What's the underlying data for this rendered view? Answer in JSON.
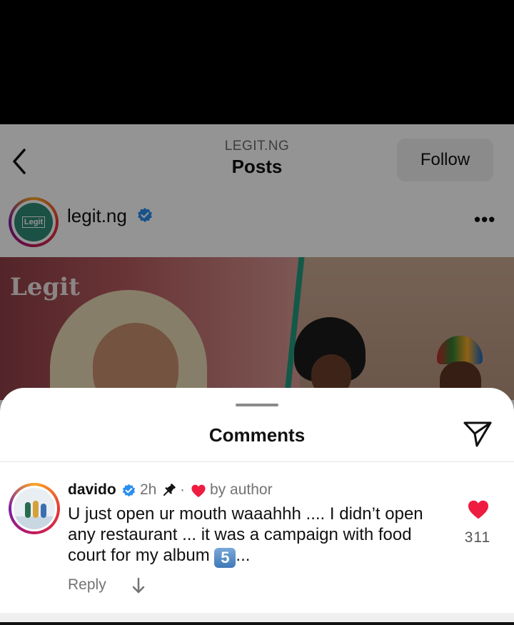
{
  "header": {
    "subtitle": "LEGIT.NG",
    "title": "Posts",
    "follow_label": "Follow"
  },
  "account": {
    "username": "legit.ng",
    "logo_text": "Legit"
  },
  "photo": {
    "watermark": "Legit"
  },
  "comments_sheet": {
    "title": "Comments",
    "comment": {
      "username": "davido",
      "time": "2h",
      "separator": "·",
      "liked_by": "by author",
      "text_main": "U just open ur mouth waaahhh .... I didn’t open any restaurant ... it was a campaign with food court for my album ",
      "emoji_label": "5",
      "text_tail": "...",
      "like_count": "311",
      "reply_label": "Reply"
    }
  },
  "colors": {
    "like_red": "#ed1c40",
    "verified_blue": "#2b8ef0",
    "muted_text": "#737373"
  },
  "icons": {
    "back": "chevron-left-icon",
    "verified": "verified-badge-icon",
    "more": "more-dots-icon",
    "share": "send-icon",
    "pin": "pin-icon",
    "heart": "heart-icon",
    "reply_arrow": "arrow-down-icon"
  }
}
